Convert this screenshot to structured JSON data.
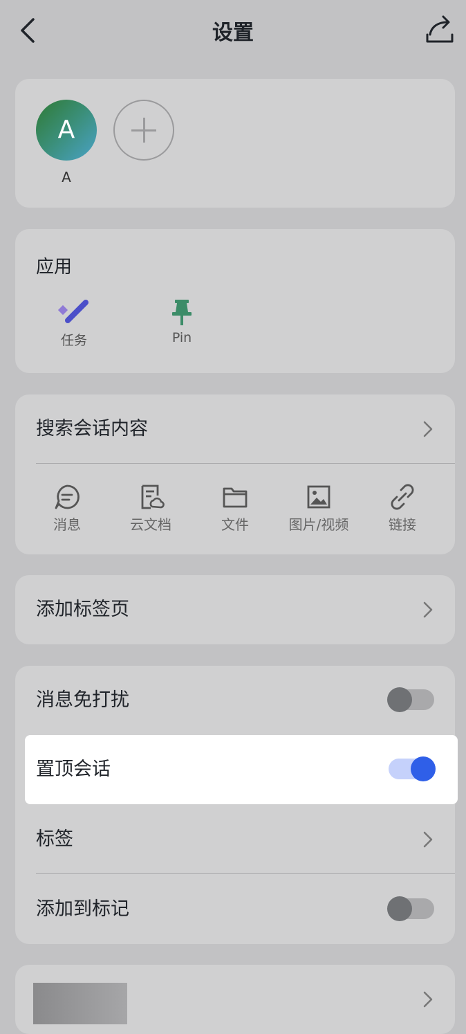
{
  "header": {
    "title": "设置",
    "back_icon": "chevron-left-icon",
    "share_icon": "share-icon"
  },
  "members": [
    {
      "avatar_letter": "A",
      "name": "A"
    }
  ],
  "apps": {
    "title": "应用",
    "items": [
      {
        "label": "任务",
        "icon": "task-icon"
      },
      {
        "label": "Pin",
        "icon": "pin-icon"
      }
    ]
  },
  "search": {
    "label": "搜索会话内容",
    "categories": [
      {
        "label": "消息",
        "icon": "message-icon"
      },
      {
        "label": "云文档",
        "icon": "cloud-doc-icon"
      },
      {
        "label": "文件",
        "icon": "folder-icon"
      },
      {
        "label": "图片/视频",
        "icon": "image-icon"
      },
      {
        "label": "链接",
        "icon": "link-icon"
      }
    ]
  },
  "add_tab": {
    "label": "添加标签页"
  },
  "settings": {
    "mute": {
      "label": "消息免打扰",
      "on": false
    },
    "pin_chat": {
      "label": "置顶会话",
      "on": true
    },
    "tags": {
      "label": "标签"
    },
    "add_to_mark": {
      "label": "添加到标记",
      "on": false
    }
  },
  "colors": {
    "accent": "#2f5fe8",
    "background": "#c2c2c4",
    "card": "#d0d0d1"
  }
}
